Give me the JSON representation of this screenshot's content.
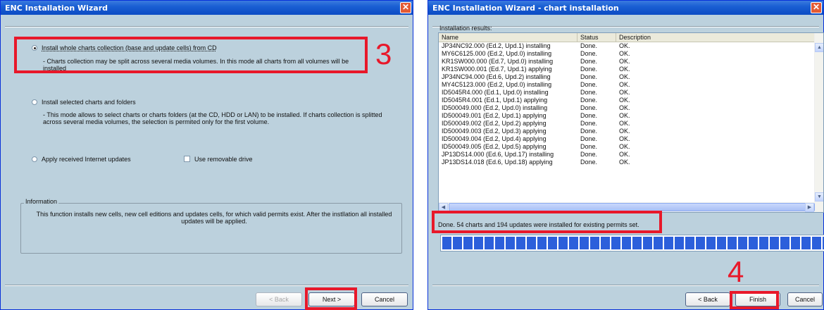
{
  "left_window": {
    "title": "ENC Installation Wizard",
    "options": [
      {
        "label": "Install whole charts collection (base and update cells) from CD",
        "selected": true,
        "description": "- Charts collection may be split across several media volumes. In this mode all charts from all volumes will be installed"
      },
      {
        "label": "Install selected charts and folders",
        "selected": false,
        "description": "- This mode allows  to select charts or charts folders (at  the CD, HDD or LAN) to be installed. If charts collection is splitted across several media volumes, the selection is permited only for the first volume."
      },
      {
        "label": "Apply received Internet updates",
        "selected": false
      }
    ],
    "removable_drive_label": "Use removable drive",
    "info_group_title": "Information",
    "info_text": "This function installs new cells, new cell editions and updates cells, for which valid permits exist. After the instllation all installed updates will be applied.",
    "buttons": {
      "back": "< Back",
      "next": "Next >",
      "cancel": "Cancel"
    },
    "step_marker": "3",
    "colors": {
      "highlight": "#e8182a",
      "title_bar": "#0b4bc4"
    }
  },
  "right_window": {
    "title": "ENC Installation Wizard - chart installation",
    "results_label": "Installation results:",
    "columns": [
      "Name",
      "Status",
      "Description"
    ],
    "rows": [
      [
        "JP34NC92.000 (Ed.2, Upd.1) installing",
        "Done.",
        "OK."
      ],
      [
        "MY6C6125.000 (Ed.2, Upd.0) installing",
        "Done.",
        "OK."
      ],
      [
        "KR1SW000.000 (Ed.7, Upd.0) installing",
        "Done.",
        "OK."
      ],
      [
        "KR1SW000.001 (Ed.7, Upd.1) applying",
        "Done.",
        "OK."
      ],
      [
        "JP34NC94.000 (Ed.6, Upd.2) installing",
        "Done.",
        "OK."
      ],
      [
        "MY4C5123.000 (Ed.2, Upd.0) installing",
        "Done.",
        "OK."
      ],
      [
        "ID5045R4.000 (Ed.1, Upd.0) installing",
        "Done.",
        "OK."
      ],
      [
        "ID5045R4.001 (Ed.1, Upd.1) applying",
        "Done.",
        "OK."
      ],
      [
        "ID500049.000 (Ed.2, Upd.0) installing",
        "Done.",
        "OK."
      ],
      [
        "ID500049.001 (Ed.2, Upd.1) applying",
        "Done.",
        "OK."
      ],
      [
        "ID500049.002 (Ed.2, Upd.2) applying",
        "Done.",
        "OK."
      ],
      [
        "ID500049.003 (Ed.2, Upd.3) applying",
        "Done.",
        "OK."
      ],
      [
        "ID500049.004 (Ed.2, Upd.4) applying",
        "Done.",
        "OK."
      ],
      [
        "ID500049.005 (Ed.2, Upd.5) applying",
        "Done.",
        "OK."
      ],
      [
        "JP13DS14.000 (Ed.6, Upd.17) installing",
        "Done.",
        "OK."
      ],
      [
        "JP13DS14.018 (Ed.6, Upd.18) applying",
        "Done.",
        "OK."
      ]
    ],
    "status_text": "Done.  54 charts and 194 updates were installed for existing permits set.",
    "progress": 1.0,
    "buttons": {
      "back": "< Back",
      "finish": "Finish",
      "cancel": "Cancel"
    },
    "step_marker": "4"
  }
}
